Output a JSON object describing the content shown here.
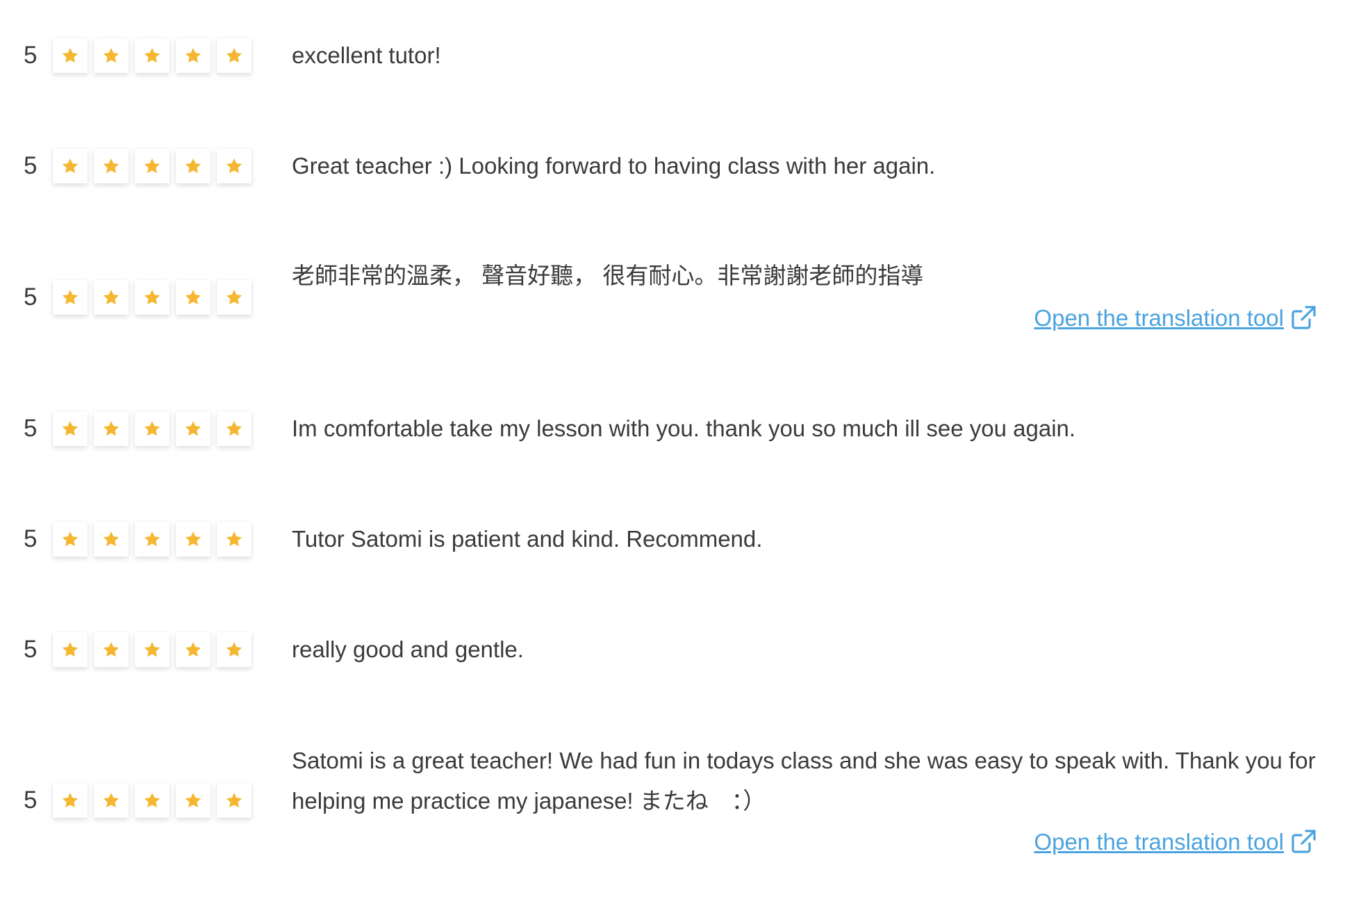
{
  "colors": {
    "star": "#f5b731",
    "link": "#4aa3df",
    "text": "#3a3a3a"
  },
  "icons": {
    "star": "star-icon",
    "external_link": "external-link-icon"
  },
  "reviews": [
    {
      "rating": "5",
      "stars": 5,
      "comment": "excellent tutor!"
    },
    {
      "rating": "5",
      "stars": 5,
      "comment": "Great teacher :) Looking forward to having class with her again."
    },
    {
      "rating": "5",
      "stars": 5,
      "comment": "老師非常的溫柔， 聲音好聽， 很有耐心。非常謝謝老師的指導",
      "translate_label": "Open the translation tool"
    },
    {
      "rating": "5",
      "stars": 5,
      "comment": "Im comfortable take my lesson with you. thank you so much ill see you again."
    },
    {
      "rating": "5",
      "stars": 5,
      "comment": "Tutor Satomi is patient and kind. Recommend."
    },
    {
      "rating": "5",
      "stars": 5,
      "comment": "really good and gentle."
    },
    {
      "rating": "5",
      "stars": 5,
      "comment": "Satomi is a great teacher! We had fun in todays class and she was easy to speak with. Thank you for helping me practice my japanese! またね　：）",
      "translate_label": "Open the translation tool"
    }
  ]
}
